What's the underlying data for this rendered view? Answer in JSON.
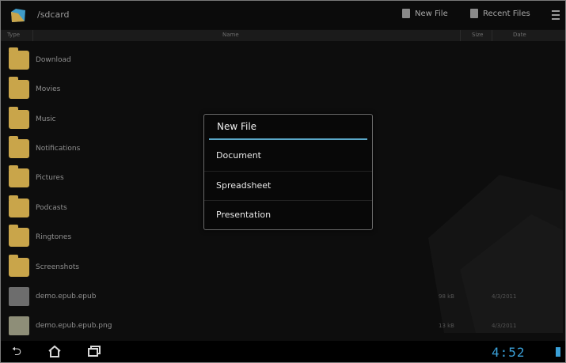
{
  "topbar": {
    "path": "/sdcard",
    "new_file": "New File",
    "recent_files": "Recent Files"
  },
  "columns": {
    "type": "Type",
    "name": "Name",
    "size": "Size",
    "date": "Date"
  },
  "files": [
    {
      "name": "Download",
      "icon": "folder-icon"
    },
    {
      "name": "Movies",
      "icon": "folder-icon"
    },
    {
      "name": "Music",
      "icon": "folder-icon"
    },
    {
      "name": "Notifications",
      "icon": "folder-icon"
    },
    {
      "name": "Pictures",
      "icon": "folder-icon"
    },
    {
      "name": "Podcasts",
      "icon": "folder-icon"
    },
    {
      "name": "Ringtones",
      "icon": "folder-icon"
    },
    {
      "name": "Screenshots",
      "icon": "folder-icon"
    },
    {
      "name": "demo.epub.epub",
      "icon": "file-icon",
      "size": "98 kB",
      "date": "4/3/2011"
    },
    {
      "name": "demo.epub.epub.png",
      "icon": "image-file-icon",
      "size": "13 kB",
      "date": "4/3/2011"
    }
  ],
  "dialog": {
    "title": "New File",
    "options": [
      "Document",
      "Spreadsheet",
      "Presentation"
    ],
    "accent": "#5aa8c8"
  },
  "sysbar": {
    "time": "4:52"
  },
  "colors": {
    "folder": "#c9a54a",
    "clock": "#3aa0d8"
  }
}
